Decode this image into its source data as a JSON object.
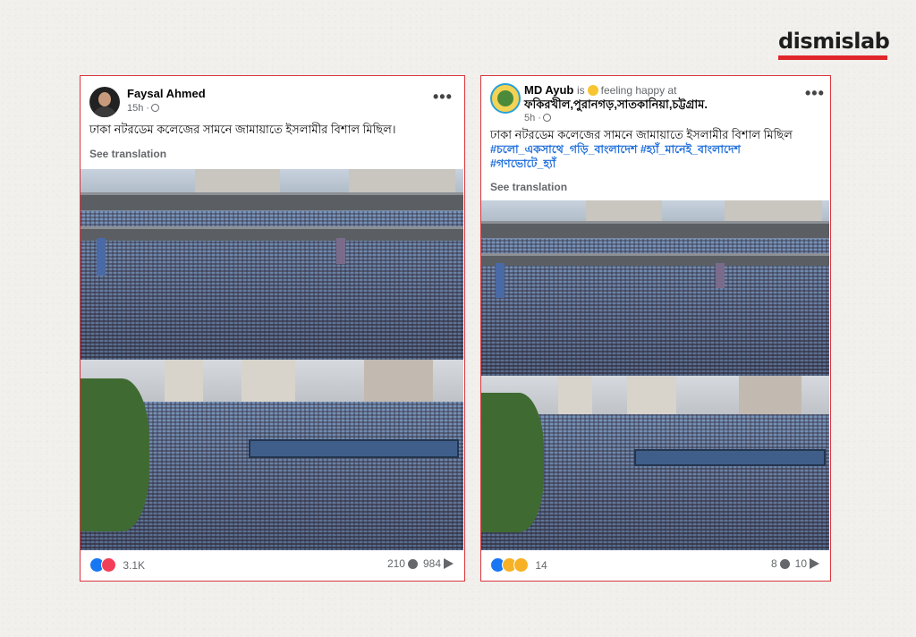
{
  "brand": {
    "name": "dismislab",
    "accent": "#e0262b"
  },
  "posts": [
    {
      "author": "Faysal Ahmed",
      "time": "15h ·",
      "text": "ঢাকা নটরডেম কলেজের সামনে জামায়াতে ইসলামীর বিশাল মিছিল।",
      "see_translation": "See translation",
      "reactions": "3.1K",
      "comments": "210",
      "shares": "984"
    },
    {
      "author": "MD Ayub",
      "status_is": "is",
      "status_feeling": "feeling happy at",
      "location": "ফকিরখীল,পুরানগড়,সাতকানিয়া,চট্টগ্রাম.",
      "time": "5h ·",
      "text": "ঢাকা নটরডেম কলেজের সামনে জামায়াতে ইসলামীর বিশাল মিছিল",
      "hashtags_line1": "#চলো_একসাথে_গড়ি_বাংলাদেশ #হ্যাঁ_মানেই_বাংলাদেশ",
      "hashtags_line2": "#গণভোটে_হ্যাঁ",
      "see_translation": "See translation",
      "reactions": "14",
      "comments": "8",
      "shares": "10"
    }
  ],
  "icons": {
    "more": "more-options-icon",
    "globe": "globe-icon",
    "comment": "comment-icon",
    "share": "share-icon"
  }
}
